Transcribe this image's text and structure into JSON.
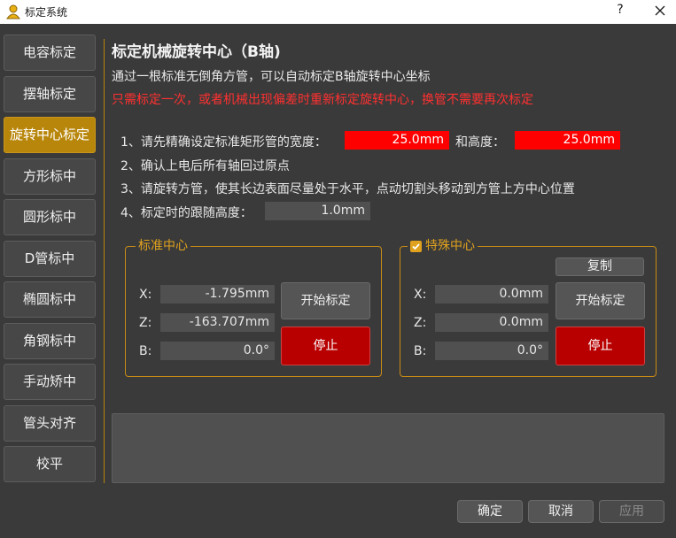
{
  "window": {
    "title": "标定系统",
    "help": "?"
  },
  "nav": [
    {
      "label": "电容标定"
    },
    {
      "label": "摆轴标定"
    },
    {
      "label": "旋转中心标定",
      "active": true
    },
    {
      "label": "方形标中"
    },
    {
      "label": "圆形标中"
    },
    {
      "label": "D管标中"
    },
    {
      "label": "椭圆标中"
    },
    {
      "label": "角钢标中"
    },
    {
      "label": "手动矫中"
    },
    {
      "label": "管头对齐"
    },
    {
      "label": "校平"
    }
  ],
  "main": {
    "heading": "标定机械旋转中心（B轴)",
    "description": "通过一根标准无倒角方管，可以自动标定B轴旋转中心坐标",
    "warning": "只需标定一次，或者机械出现偏差时重新标定旋转中心，换管不需要再次标定",
    "steps": {
      "s1_prefix": "1、请先精确设定标准矩形管的宽度：",
      "s1_width": "25.0mm",
      "s1_height_label": "和高度：",
      "s1_height": "25.0mm",
      "s2": "2、确认上电后所有轴回过原点",
      "s3": "3、请旋转方管，使其长边表面尽量处于水平，点动切割头移动到方管上方中心位置",
      "s4_label": "4、标定时的跟随高度：",
      "s4_value": "1.0mm"
    }
  },
  "standard_center": {
    "title": "标准中心",
    "x_label": "X:",
    "x_value": "-1.795mm",
    "z_label": "Z:",
    "z_value": "-163.707mm",
    "b_label": "B:",
    "b_value": "0.0°",
    "start_label": "开始标定",
    "stop_label": "停止"
  },
  "special_center": {
    "title": "特殊中心",
    "checked": true,
    "copy_label": "复制",
    "x_label": "X:",
    "x_value": "0.0mm",
    "z_label": "Z:",
    "z_value": "0.0mm",
    "b_label": "B:",
    "b_value": "0.0°",
    "start_label": "开始标定",
    "stop_label": "停止"
  },
  "footer": {
    "ok": "确定",
    "cancel": "取消",
    "apply": "应用"
  },
  "colors": {
    "accent": "#b8860b",
    "danger": "#b80000",
    "input_highlight": "#ff0000",
    "warning_text": "#ff3030"
  }
}
